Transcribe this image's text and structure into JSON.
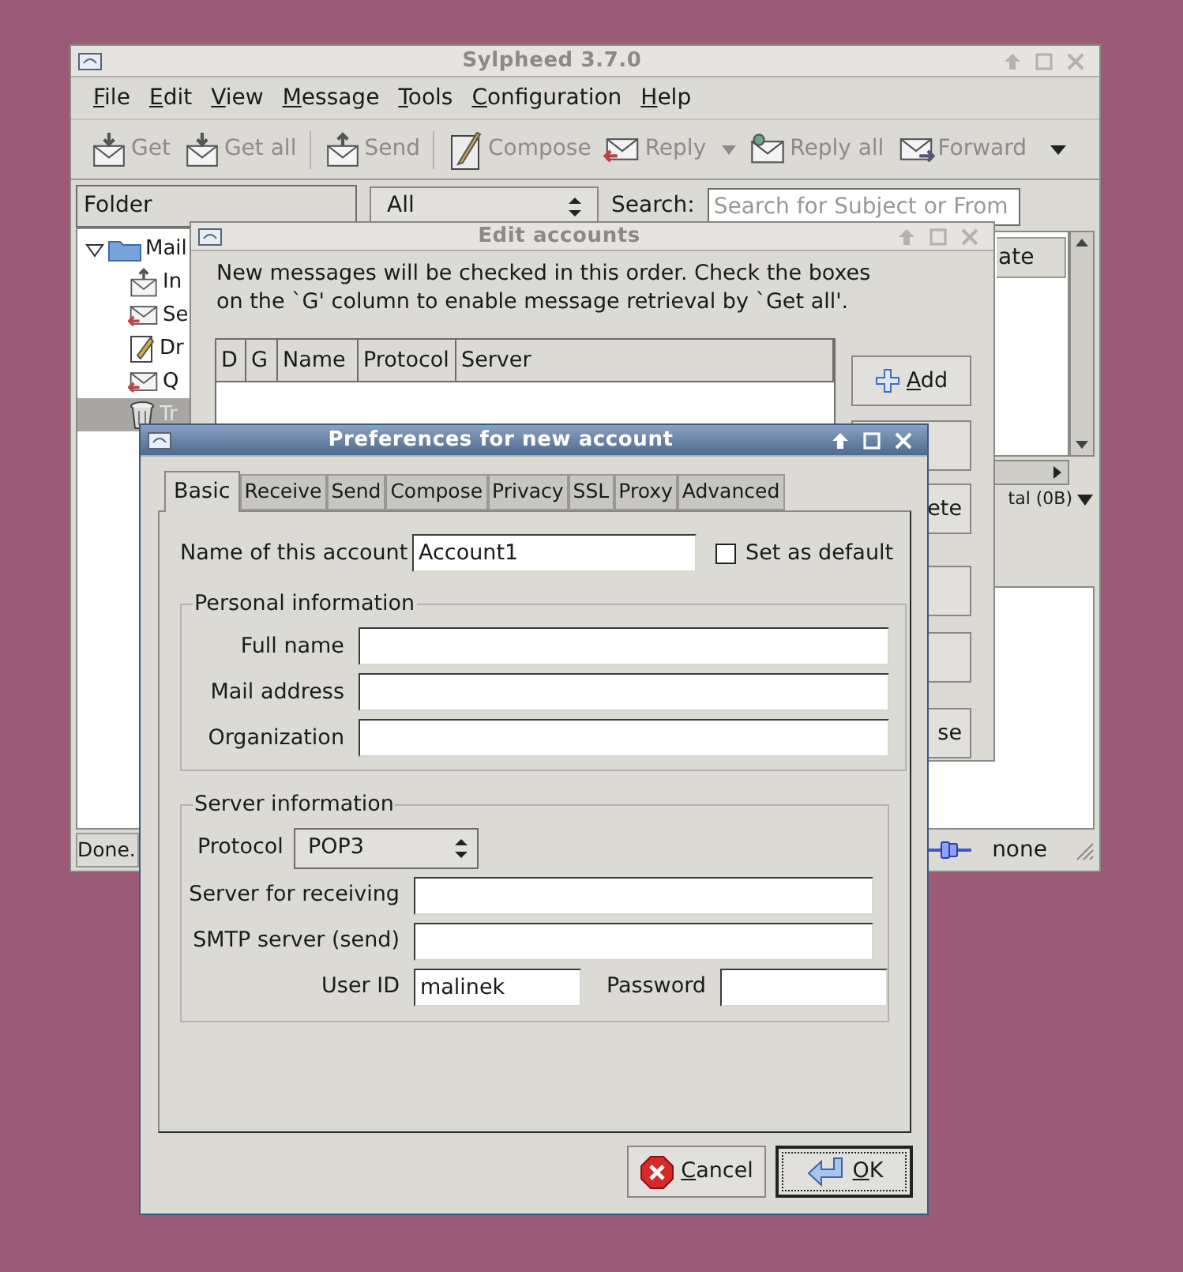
{
  "main_window": {
    "title": "Sylpheed 3.7.0",
    "active": false,
    "menu": [
      "File",
      "Edit",
      "View",
      "Message",
      "Tools",
      "Configuration",
      "Help"
    ],
    "toolbar": [
      {
        "kind": "button",
        "label": "Get",
        "disabled": true
      },
      {
        "kind": "button",
        "label": "Get all",
        "disabled": true
      },
      {
        "kind": "separator"
      },
      {
        "kind": "button",
        "label": "Send",
        "disabled": true
      },
      {
        "kind": "separator"
      },
      {
        "kind": "button",
        "label": "Compose",
        "disabled": true
      },
      {
        "kind": "menu_button",
        "label": "Reply",
        "disabled": true
      },
      {
        "kind": "button",
        "label": "Reply all",
        "disabled": true
      },
      {
        "kind": "button",
        "label": "Forward",
        "disabled": true
      },
      {
        "kind": "overflow"
      }
    ],
    "folder_header": "Folder",
    "folders": [
      {
        "label": "Mail",
        "expanded": true,
        "selected": false,
        "children": [
          {
            "label": "In",
            "selected": false
          },
          {
            "label": "Se",
            "selected": false
          },
          {
            "label": "Dr",
            "selected": false
          },
          {
            "label": "Q",
            "selected": false
          },
          {
            "label": "Tr",
            "selected": true
          }
        ]
      }
    ],
    "filter": "All",
    "search_label": "Search:",
    "search": {
      "placeholder": "Search for Subject or From"
    },
    "message_columns": [
      "ate"
    ],
    "summary": "tal (0B)",
    "status": "Done.",
    "online_status": "none"
  },
  "edit_accounts": {
    "title": "Edit accounts",
    "active": false,
    "message": "New messages will be checked in this order. Check the boxes\non the `G' column to enable message retrieval by `Get all'.",
    "columns": [
      "D",
      "G",
      "Name",
      "Protocol",
      "Server"
    ],
    "buttons": [
      {
        "kind": "add",
        "label": "Add"
      },
      {
        "kind": "blank"
      },
      {
        "kind": "clipped",
        "label": "ete"
      },
      {
        "kind": "blank"
      },
      {
        "kind": "blank"
      },
      {
        "kind": "clipped",
        "label": "se"
      }
    ]
  },
  "preferences": {
    "title": "Preferences for new account",
    "active": true,
    "tabs": [
      {
        "label": "Basic",
        "selected": true
      },
      {
        "label": "Receive",
        "selected": false
      },
      {
        "label": "Send",
        "selected": false
      },
      {
        "label": "Compose",
        "selected": false
      },
      {
        "label": "Privacy",
        "selected": false
      },
      {
        "label": "SSL",
        "selected": false
      },
      {
        "label": "Proxy",
        "selected": false
      },
      {
        "label": "Advanced",
        "selected": false
      }
    ],
    "account_name_label": "Name of this account",
    "account_name": "Account1",
    "set_default": {
      "label": "Set as default",
      "checked": false
    },
    "personal": {
      "title": "Personal information",
      "fields": [
        {
          "label": "Full name"
        },
        {
          "label": "Mail address"
        },
        {
          "label": "Organization"
        }
      ]
    },
    "server": {
      "title": "Server information",
      "protocol_label": "Protocol",
      "protocol": "POP3",
      "fields": [
        {
          "label": "Server for receiving"
        },
        {
          "label": "SMTP server (send)"
        }
      ],
      "user_id_label": "User ID",
      "user_id": "malinek",
      "password_label": "Password"
    },
    "buttons": [
      {
        "kind": "cancel",
        "label": "Cancel",
        "focused": false
      },
      {
        "kind": "ok",
        "label": "OK",
        "focused": true
      }
    ]
  }
}
